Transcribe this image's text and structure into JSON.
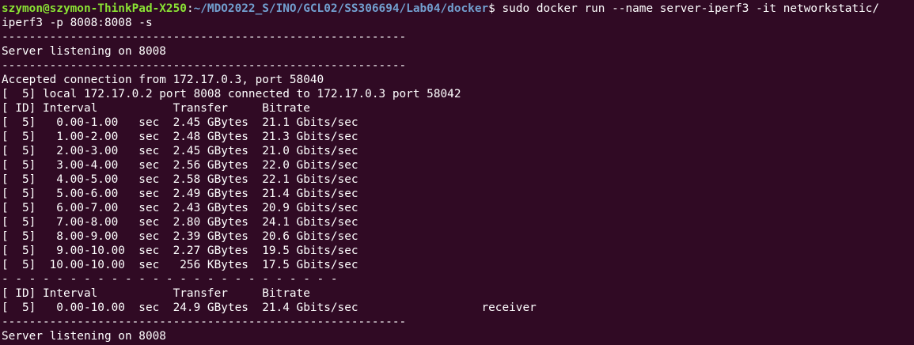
{
  "prompt": {
    "user_host": "szymon@szymon-ThinkPad-X250",
    "separator": ":",
    "path": "~/MDO2022_S/INO/GCL02/SS306694/Lab04/docker",
    "symbol": "$ ",
    "command": "sudo docker run --name server-iperf3 -it networkstatic/",
    "command_wrap": "iperf3 -p 8008:8008 -s"
  },
  "output": {
    "rule_long": "-----------------------------------------------------------",
    "server_listening": "Server listening on 8008",
    "accepted": "Accepted connection from 172.17.0.3, port 58040",
    "local_conn": "[  5] local 172.17.0.2 port 8008 connected to 172.17.0.3 port 58042",
    "header": "[ ID] Interval           Transfer     Bitrate",
    "intervals": [
      "[  5]   0.00-1.00   sec  2.45 GBytes  21.1 Gbits/sec",
      "[  5]   1.00-2.00   sec  2.48 GBytes  21.3 Gbits/sec",
      "[  5]   2.00-3.00   sec  2.45 GBytes  21.0 Gbits/sec",
      "[  5]   3.00-4.00   sec  2.56 GBytes  22.0 Gbits/sec",
      "[  5]   4.00-5.00   sec  2.58 GBytes  22.1 Gbits/sec",
      "[  5]   5.00-6.00   sec  2.49 GBytes  21.4 Gbits/sec",
      "[  5]   6.00-7.00   sec  2.43 GBytes  20.9 Gbits/sec",
      "[  5]   7.00-8.00   sec  2.80 GBytes  24.1 Gbits/sec",
      "[  5]   8.00-9.00   sec  2.39 GBytes  20.6 Gbits/sec",
      "[  5]   9.00-10.00  sec  2.27 GBytes  19.5 Gbits/sec",
      "[  5]  10.00-10.00  sec   256 KBytes  17.5 Gbits/sec"
    ],
    "rule_dashed": "- - - - - - - - - - - - - - - - - - - - - - - - -",
    "summary_header": "[ ID] Interval           Transfer     Bitrate",
    "summary": "[  5]   0.00-10.00  sec  24.9 GBytes  21.4 Gbits/sec                  receiver",
    "server_listening_again": "Server listening on 8008"
  },
  "colors": {
    "background": "#300a24",
    "user_host": "#8ae234",
    "path": "#729fcf",
    "text": "#ffffff"
  }
}
